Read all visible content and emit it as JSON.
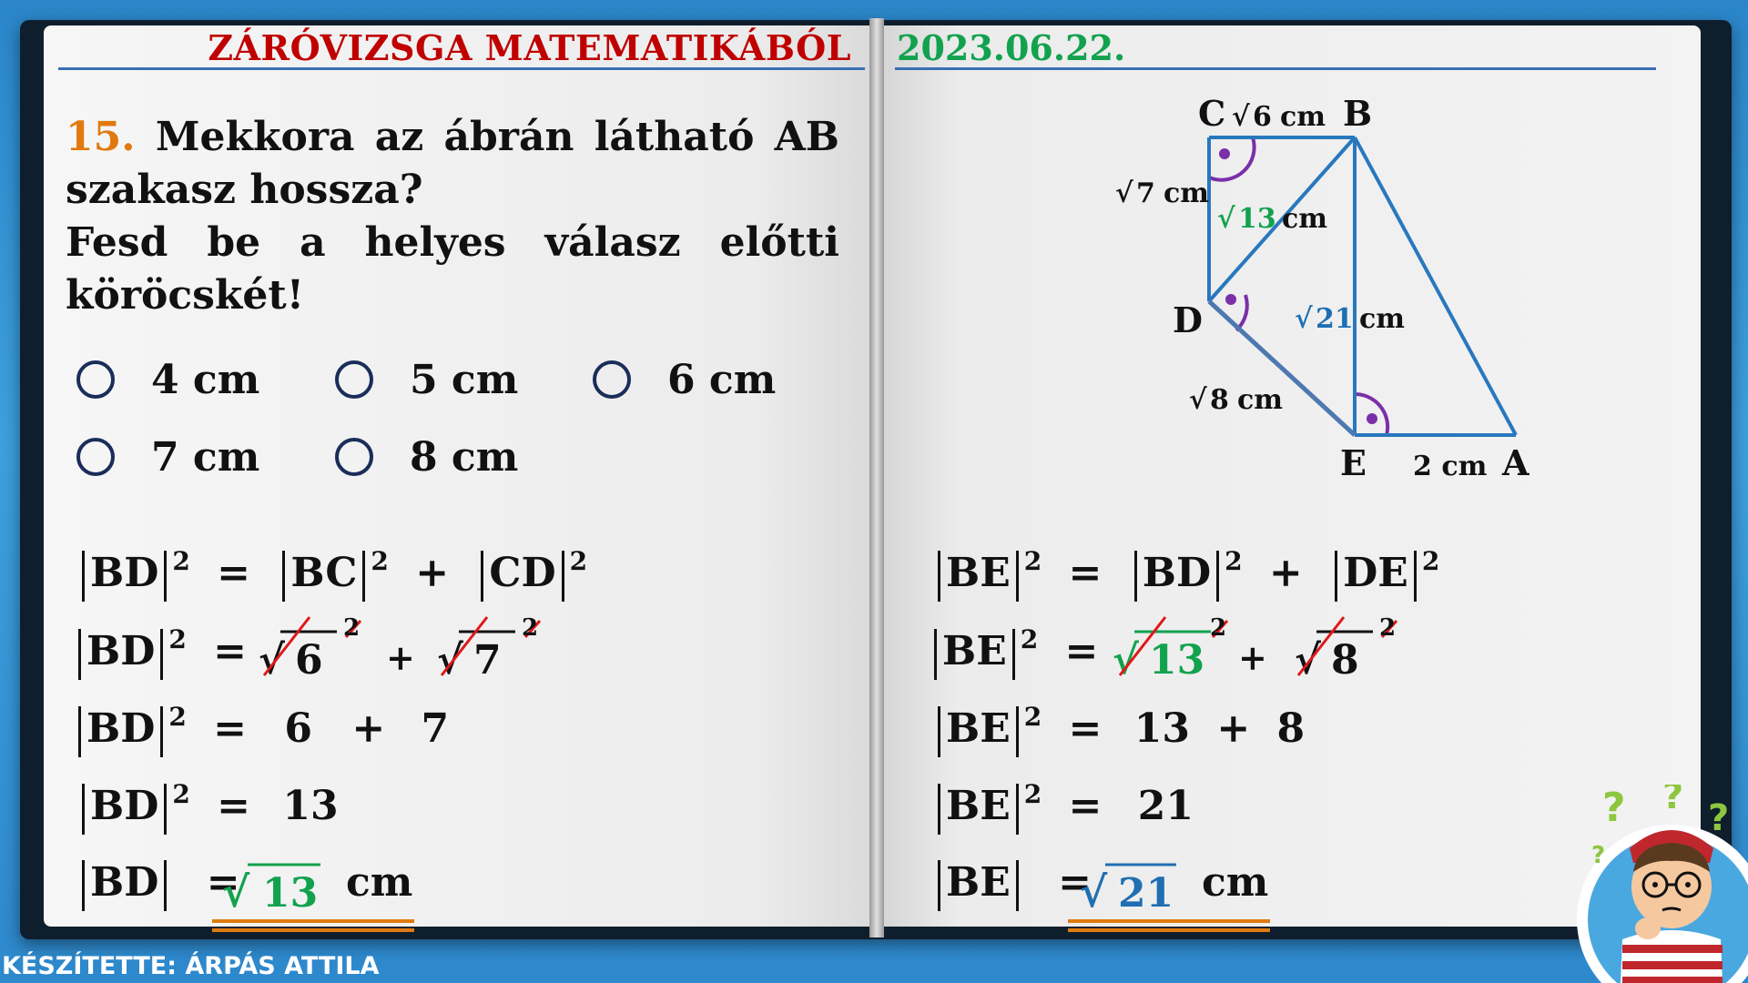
{
  "header": {
    "title": "ZÁRÓVIZSGA MATEMATIKÁBÓL",
    "date": "2023.06.22."
  },
  "question": {
    "number": "15.",
    "text1": "Mekkora az ábrán látható AB szakasz hossza?",
    "text2": "Fesd be a helyes válasz előtti köröcskét!"
  },
  "options": [
    "4 cm",
    "5 cm",
    "6 cm",
    "7 cm",
    "8 cm"
  ],
  "figure": {
    "labels": {
      "C": "C",
      "B": "B",
      "D": "D",
      "E": "E",
      "A": "A"
    },
    "bc": "6",
    "cd": "7",
    "bd": "13",
    "be": "21",
    "de": "8",
    "ea": "2 cm",
    "unit": "cm"
  },
  "left_eqs": {
    "bd": "BD",
    "bc": "BC",
    "cd": "CD",
    "sq": "2",
    "eq": "=",
    "plus": "+",
    "r6": "6",
    "r7": "7",
    "n6": "6",
    "n7": "7",
    "s13": "13",
    "res": "13",
    "unit": "cm"
  },
  "right_eqs": {
    "be": "BE",
    "bd": "BD",
    "de": "DE",
    "r13": "13",
    "r8": "8",
    "n13": "13",
    "n8": "8",
    "s21": "21",
    "res": "21",
    "unit": "cm"
  },
  "credit": "KÉSZÍTETTE: ÁRPÁS ATTILA",
  "colors": {
    "accent_red": "#c00000",
    "accent_green": "#12a24e",
    "accent_blue": "#1f6fb2",
    "accent_orange": "#e07a10"
  }
}
